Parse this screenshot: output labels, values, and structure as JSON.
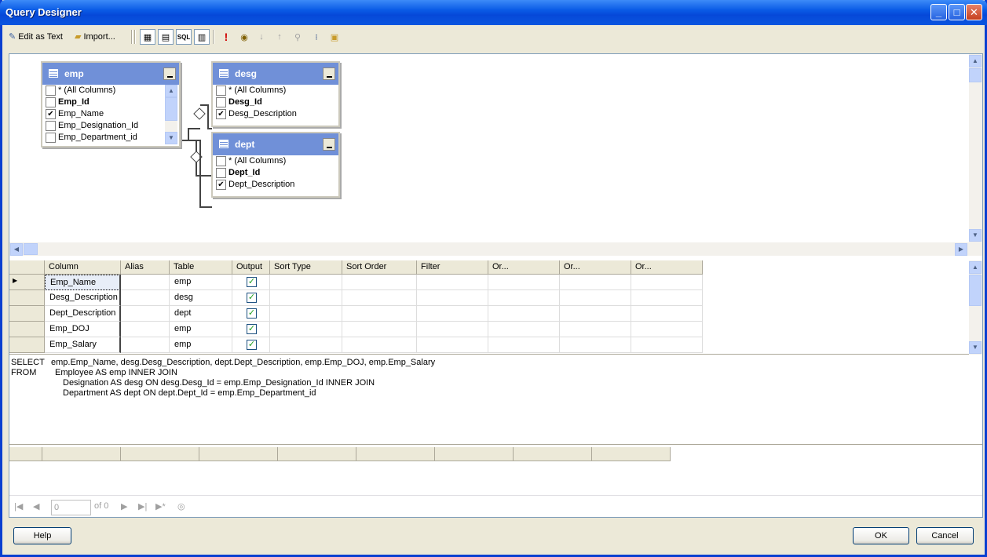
{
  "window": {
    "title": "Query Designer"
  },
  "toolbar": {
    "edit_as_text": "Edit as Text",
    "import": "Import..."
  },
  "tables": [
    {
      "name": "emp",
      "columns": [
        {
          "label": "* (All Columns)",
          "checked": false,
          "bold": false
        },
        {
          "label": "Emp_Id",
          "checked": false,
          "bold": true
        },
        {
          "label": "Emp_Name",
          "checked": true,
          "bold": false
        },
        {
          "label": "Emp_Designation_Id",
          "checked": false,
          "bold": false
        },
        {
          "label": "Emp_Department_id",
          "checked": false,
          "bold": false
        }
      ]
    },
    {
      "name": "desg",
      "columns": [
        {
          "label": "* (All Columns)",
          "checked": false,
          "bold": false
        },
        {
          "label": "Desg_Id",
          "checked": false,
          "bold": true
        },
        {
          "label": "Desg_Description",
          "checked": true,
          "bold": false
        }
      ]
    },
    {
      "name": "dept",
      "columns": [
        {
          "label": "* (All Columns)",
          "checked": false,
          "bold": false
        },
        {
          "label": "Dept_Id",
          "checked": false,
          "bold": true
        },
        {
          "label": "Dept_Description",
          "checked": true,
          "bold": false
        }
      ]
    }
  ],
  "grid": {
    "headers": [
      "Column",
      "Alias",
      "Table",
      "Output",
      "Sort Type",
      "Sort Order",
      "Filter",
      "Or...",
      "Or...",
      "Or..."
    ],
    "rows": [
      {
        "column": "Emp_Name",
        "table": "emp",
        "output": true
      },
      {
        "column": "Desg_Description",
        "table": "desg",
        "output": true
      },
      {
        "column": "Dept_Description",
        "table": "dept",
        "output": true
      },
      {
        "column": "Emp_DOJ",
        "table": "emp",
        "output": true
      },
      {
        "column": "Emp_Salary",
        "table": "emp",
        "output": true
      }
    ]
  },
  "sql": {
    "select_kw": "SELECT",
    "select_body": "emp.Emp_Name, desg.Desg_Description, dept.Dept_Description, emp.Emp_DOJ, emp.Emp_Salary",
    "from_kw": "FROM",
    "from_line1": "Employee AS emp INNER JOIN",
    "from_line2": "Designation AS desg ON desg.Desg_Id = emp.Emp_Designation_Id INNER JOIN",
    "from_line3": "Department AS dept ON dept.Dept_Id = emp.Emp_Department_id"
  },
  "navigator": {
    "position": "0",
    "of_label": "of 0"
  },
  "buttons": {
    "help": "Help",
    "ok": "OK",
    "cancel": "Cancel"
  }
}
